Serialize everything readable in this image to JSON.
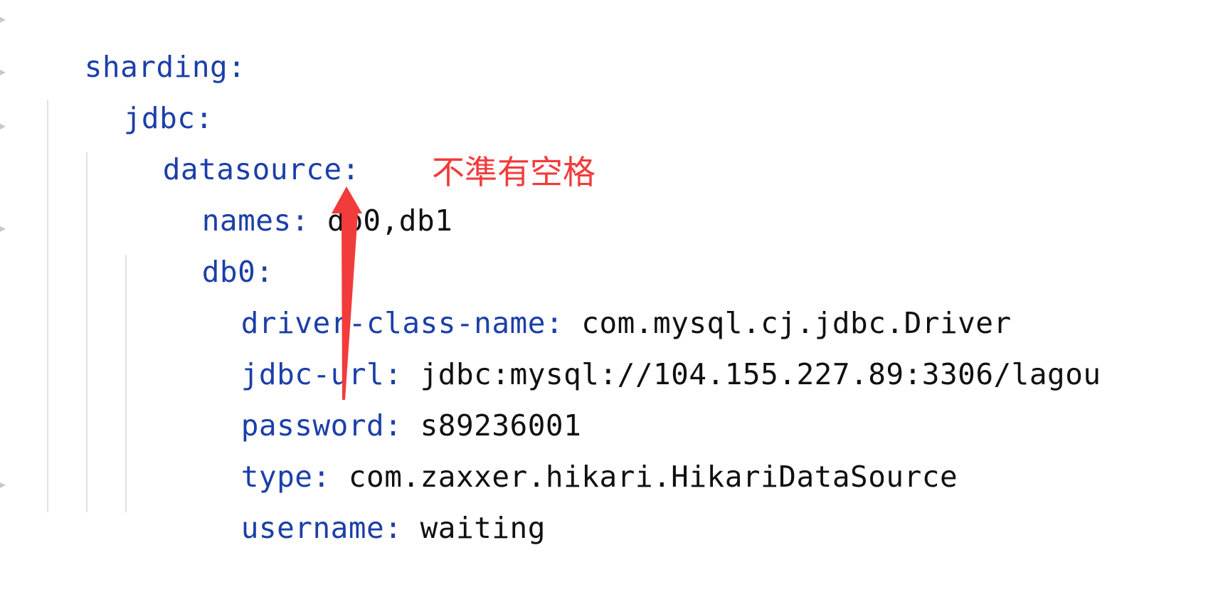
{
  "editor": {
    "lines": [
      {
        "key": "sharding",
        "colon": ":",
        "value": ""
      },
      {
        "key": "jdbc",
        "colon": ":",
        "value": ""
      },
      {
        "key": "datasource",
        "colon": ":",
        "value": ""
      },
      {
        "key": "names",
        "colon": ":",
        "value": " db0,db1"
      },
      {
        "key": "db0",
        "colon": ":",
        "value": ""
      },
      {
        "key": "driver-class-name",
        "colon": ":",
        "value": " com.mysql.cj.jdbc.Driver"
      },
      {
        "key": "jdbc-url",
        "colon": ":",
        "value": " jdbc:mysql://104.155.227.89:3306/lagou"
      },
      {
        "key": "password",
        "colon": ":",
        "value": " s89236001"
      },
      {
        "key": "type",
        "colon": ":",
        "value": " com.zaxxer.hikari.HikariDataSource"
      },
      {
        "key": "username",
        "colon": ":",
        "value": " waiting"
      }
    ]
  },
  "annotation": {
    "text": "不準有空格",
    "color": "#f23b3b"
  },
  "icons": {
    "fold_marker": "fold-marker-icon",
    "arrow": "red-arrow-icon"
  },
  "colors": {
    "key": "#1b3fa8",
    "value": "#101010",
    "guide": "#e2e2e2"
  }
}
